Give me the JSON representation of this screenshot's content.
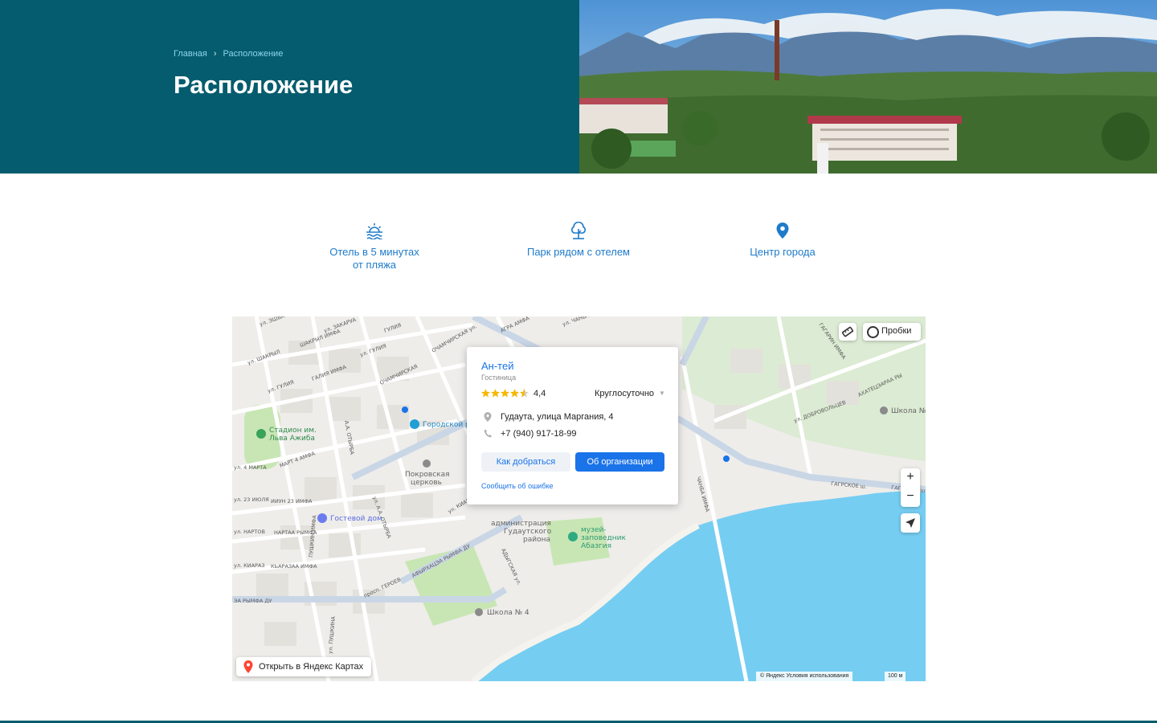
{
  "breadcrumb": {
    "home": "Главная",
    "current": "Расположение"
  },
  "page_title": "Расположение",
  "features": [
    {
      "icon": "beach-sunset-icon",
      "line1": "Отель в 5 минутах",
      "line2": "от пляжа"
    },
    {
      "icon": "park-tree-icon",
      "line1": "Парк рядом с отелем",
      "line2": ""
    },
    {
      "icon": "location-pin-icon",
      "line1": "Центр города",
      "line2": ""
    }
  ],
  "map": {
    "org": {
      "name": "Ан-тей",
      "type": "Гостиница",
      "rating": "4,4",
      "rating_value": 4.4,
      "hours": "Круглосуточно",
      "address": "Гудаута, улица Маргания, 4",
      "phone": "+7 (940) 917-18-99",
      "route_button": "Как добраться",
      "about_button": "Об организации",
      "report_link": "Сообщить об ошибке"
    },
    "traffic_label": "Пробки",
    "zoom_in": "+",
    "zoom_out": "−",
    "open_in_yandex": "Открыть в Яндекс Картах",
    "copyright": "© Яндекс   Условия использования",
    "scale": "100 м",
    "pois": {
      "stadium_line1": "Стадион им.",
      "stadium_line2": "Льва Ажиба",
      "city_park": "Городской р",
      "church_line1": "Покровская",
      "church_line2": "церковь",
      "guest_house": "Гостевой дом",
      "admin_line1": "администрация",
      "admin_line2": "Гудаутского",
      "admin_line3": "района",
      "museum_line1": "музей-",
      "museum_line2": "заповедник",
      "museum_line3": "Абазгия",
      "school_4": "Школа № 4",
      "school_right": "Школа №"
    },
    "streets": {
      "s1": "ул. ЭШБА",
      "s2": "ул. ЗАКАРУА",
      "s3": "ШАКРЫЛ ИМФА",
      "s4": "ул. ШАКРЫЛ",
      "s5": "ГУЛИЯ",
      "s6": "ул. ГУЛИЯ",
      "s7": "ГАЛИЯ ИМФА",
      "s8": "ул. ГУЛИЯ",
      "s9": "ОЧАМЧИРСКАЯ",
      "s10": "ОЧАМЧИРСКАЯ ул.",
      "s11": "МАРТ 4 АМФА",
      "s12": "ул. 4 МАРТА",
      "s13": "ул. 23 ИЮЛЯ",
      "s14": "ИИУН 23 ИМФА",
      "s15": "ул. НАРТОВ",
      "s16": "НАРТАА РЫМФА",
      "s17": "ул. КИАРАЗ",
      "s18": "КЬАРАЗАА ИМФА",
      "s19": "ЭА РЫМФА ДУ",
      "s20": "ул. ПУШКИНА",
      "s21": "ПУШКИН ИМФА",
      "s22": "просп. ГЕРОЕВ",
      "s23": "АФЫРХАЦЭА РЫМФА ДУ",
      "s24": "АДЫГСКАЯ ул.",
      "s25": "АГРА АМФА",
      "s26": "ул. ЧАНБА",
      "s27": "ЧАНБА ИМФА",
      "s28": "ул. ДОБРОВОЛЬЦЕВ",
      "s29": "АХАТЕЦЭАРАА РЫ",
      "s30": "ГАГАРИН ИМФА",
      "s31": "ГАГРСКОЕ ш.",
      "s32": "ул. КИАР",
      "s33": "А.А. ОТЫРБА",
      "s34": "ул. А.А. ОТЫРБА",
      "s35": "ГАГРСКОЕ ш."
    }
  },
  "colors": {
    "hero_bg": "#045c6e",
    "accent": "#1e7bc9",
    "map_link": "#1a73e8",
    "sea": "#76cdf2",
    "park": "#c8e6b4"
  }
}
